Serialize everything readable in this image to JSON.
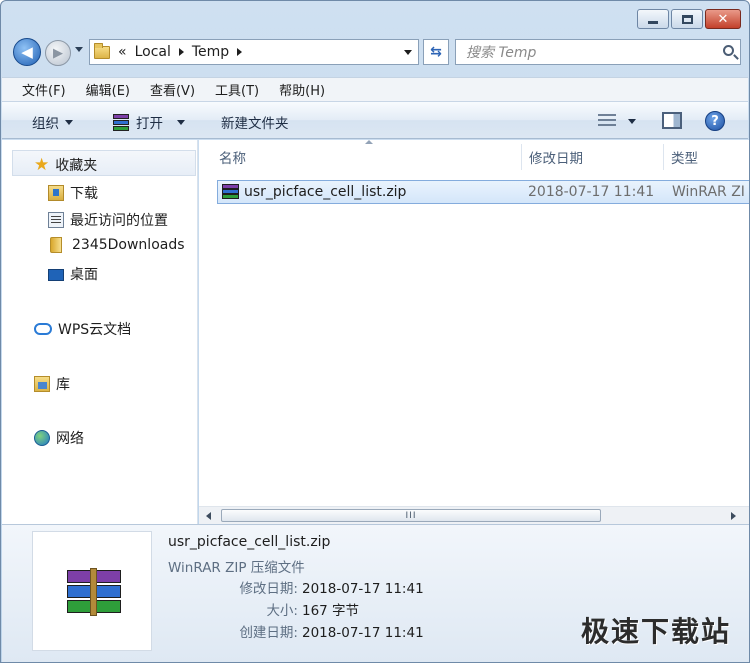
{
  "window": {
    "caption_buttons": [
      "minimize",
      "maximize",
      "close"
    ],
    "close_glyph": "✕"
  },
  "address_bar": {
    "overflow_chevron": "«",
    "crumbs": [
      "Local",
      "Temp"
    ],
    "search_placeholder": "搜索 Temp"
  },
  "menu": [
    "文件(F)",
    "编辑(E)",
    "查看(V)",
    "工具(T)",
    "帮助(H)"
  ],
  "toolbar": {
    "organize": "组织",
    "open": "打开",
    "new_folder": "新建文件夹",
    "help_glyph": "?"
  },
  "nav_pane": {
    "favorites": "收藏夹",
    "items": [
      "下载",
      "最近访问的位置",
      "2345Downloads",
      "桌面"
    ],
    "wps_cloud": "WPS云文档",
    "library": "库",
    "network": "网络"
  },
  "columns": [
    "名称",
    "修改日期",
    "类型"
  ],
  "files": [
    {
      "name": "usr_picface_cell_list.zip",
      "modified": "2018-07-17 11:41",
      "type": "WinRAR ZI"
    }
  ],
  "scrollbar": {
    "grip": "III"
  },
  "details": {
    "name": "usr_picface_cell_list.zip",
    "type": "WinRAR ZIP 压缩文件",
    "modified_label": "修改日期:",
    "modified_value": "2018-07-17 11:41",
    "size_label": "大小:",
    "size_value": "167 字节",
    "created_label": "创建日期:",
    "created_value": "2018-07-17 11:41"
  },
  "watermark": "极速下载站",
  "colors": {
    "rar_purple": "#7d3fa8",
    "rar_blue": "#2f6fd0",
    "rar_green": "#2e9e3a"
  }
}
